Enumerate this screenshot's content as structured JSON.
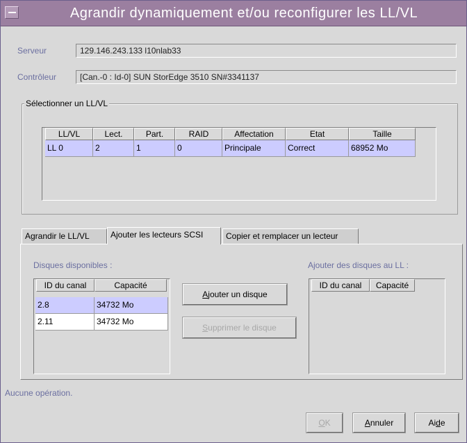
{
  "window": {
    "title": "Agrandir dynamiquement et/ou reconfigurer les LL/VL"
  },
  "server": {
    "label": "Serveur",
    "value": "129.146.243.133 l10nlab33"
  },
  "controller": {
    "label": "Contrôleur",
    "value": "[Can.-0 : Id-0] SUN StorEdge 3510 SN#3341137"
  },
  "select_group": {
    "label": "Sélectionner un LL/VL",
    "columns": [
      "LL/VL",
      "Lect.",
      "Part.",
      "RAID",
      "Affectation",
      "Etat",
      "Taille"
    ],
    "rows": [
      [
        "LL 0",
        "2",
        "1",
        "0",
        "Principale",
        "Correct",
        "68952 Mo"
      ]
    ]
  },
  "tabs": [
    {
      "label": "Agrandir le LL/VL"
    },
    {
      "label": "Ajouter les lecteurs SCSI"
    },
    {
      "label": "Copier et remplacer un lecteur"
    }
  ],
  "available": {
    "label": "Disques disponibles :",
    "columns": [
      "ID du canal",
      "Capacité"
    ],
    "rows": [
      [
        "2.8",
        "34732 Mo"
      ],
      [
        "2.11",
        "34732 Mo"
      ]
    ]
  },
  "add_to_ll": {
    "label": "Ajouter des disques au LL :",
    "columns": [
      "ID du canal",
      "Capacité"
    ]
  },
  "buttons": {
    "add_disk": {
      "mnemonic": "A",
      "rest": "jouter un disque"
    },
    "remove_disk": {
      "mnemonic": "S",
      "rest": "upprimer le disque"
    },
    "ok": {
      "mnemonic": "O",
      "rest": "K"
    },
    "cancel": {
      "mnemonic": "A",
      "rest": "nnuler"
    },
    "help": {
      "pre": "Ai",
      "mnemonic": "d",
      "rest": "e"
    }
  },
  "status": "Aucune opération.",
  "colors": {
    "titlebar": "#9b7fa0",
    "selection": "#ccccff",
    "window_bg": "#d9d9d9"
  }
}
